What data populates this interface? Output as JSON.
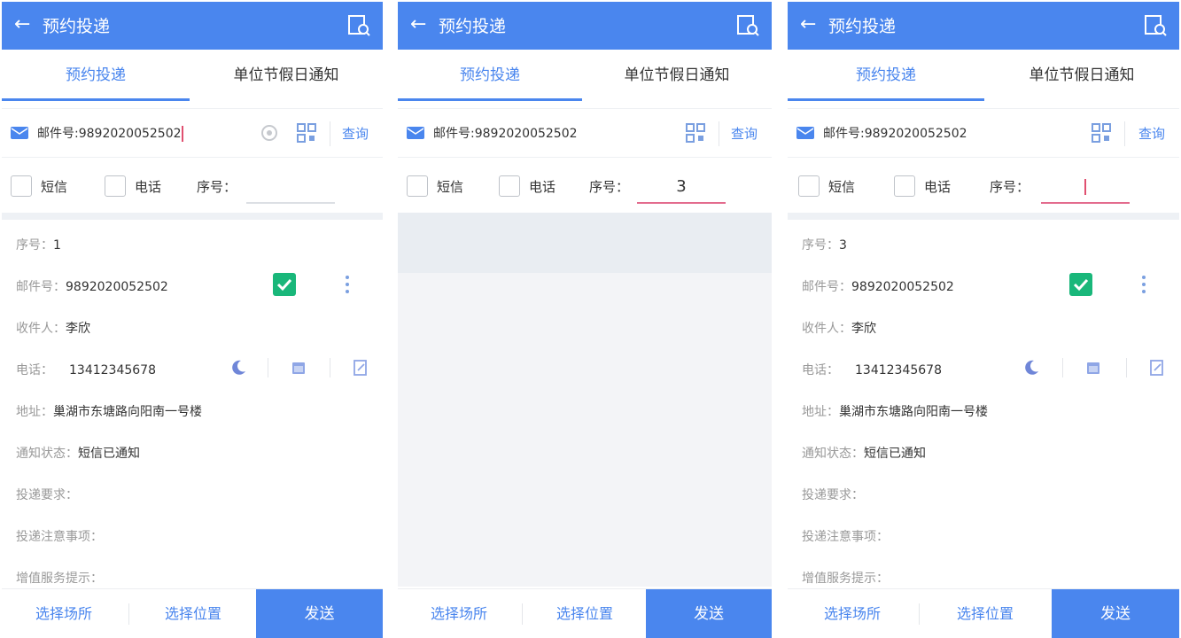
{
  "panels": [
    {
      "header": {
        "title": "预约投递"
      },
      "tabs": [
        {
          "label": "预约投递"
        },
        {
          "label": "单位节假日通知"
        }
      ],
      "search": {
        "prefix": "邮件号:",
        "value": "9892020052502",
        "query_label": "查询"
      },
      "filters": {
        "sms_label": "短信",
        "phone_label": "电话",
        "seq_label": "序号：",
        "seq_value": ""
      },
      "detail": {
        "seq_label": "序号：",
        "seq_value": "1",
        "mail_label": "邮件号：",
        "mail_value": "9892020052502",
        "recipient_label": "收件人：",
        "recipient_value": "李欣",
        "phone_label": "电话：",
        "phone_value": "13412345678",
        "address_label": "地址：",
        "address_value": "巢湖市东塘路向阳南一号楼",
        "notify_label": "通知状态：",
        "notify_value": "短信已通知",
        "req_label": "投递要求：",
        "notes_label": "投递注意事项：",
        "value_added_label": "增值服务提示："
      },
      "bottom": {
        "place_label": "选择场所",
        "location_label": "选择位置",
        "send_label": "发送"
      }
    },
    {
      "header": {
        "title": "预约投递"
      },
      "tabs": [
        {
          "label": "预约投递"
        },
        {
          "label": "单位节假日通知"
        }
      ],
      "search": {
        "prefix": "邮件号:",
        "value": "9892020052502",
        "query_label": "查询"
      },
      "filters": {
        "sms_label": "短信",
        "phone_label": "电话",
        "seq_label": "序号：",
        "seq_value": "3"
      },
      "bottom": {
        "place_label": "选择场所",
        "location_label": "选择位置",
        "send_label": "发送"
      }
    },
    {
      "header": {
        "title": "预约投递"
      },
      "tabs": [
        {
          "label": "预约投递"
        },
        {
          "label": "单位节假日通知"
        }
      ],
      "search": {
        "prefix": "邮件号:",
        "value": "9892020052502",
        "query_label": "查询"
      },
      "filters": {
        "sms_label": "短信",
        "phone_label": "电话",
        "seq_label": "序号：",
        "seq_value": ""
      },
      "detail": {
        "seq_label": "序号：",
        "seq_value": "3",
        "mail_label": "邮件号：",
        "mail_value": "9892020052502",
        "recipient_label": "收件人：",
        "recipient_value": "李欣",
        "phone_label": "电话：",
        "phone_value": "13412345678",
        "address_label": "地址：",
        "address_value": "巢湖市东塘路向阳南一号楼",
        "notify_label": "通知状态：",
        "notify_value": "短信已通知",
        "req_label": "投递要求：",
        "notes_label": "投递注意事项：",
        "value_added_label": "增值服务提示："
      },
      "bottom": {
        "place_label": "选择场所",
        "location_label": "选择位置",
        "send_label": "发送"
      }
    }
  ],
  "icons": {
    "back": "arrow-left-icon",
    "scan": "doc-search-icon",
    "mail": "envelope-icon",
    "clear": "clear-circle-icon",
    "qr": "qr-scan-icon",
    "check": "checkmark-icon",
    "more": "vertical-dots-icon",
    "night": "moon-icon",
    "calendar": "calendar-icon",
    "edit": "edit-icon"
  },
  "colors": {
    "primary": "#4a86ee",
    "check_green": "#19b77a",
    "caret": "#e05070",
    "seq_underline_focus": "#e36b8d"
  }
}
